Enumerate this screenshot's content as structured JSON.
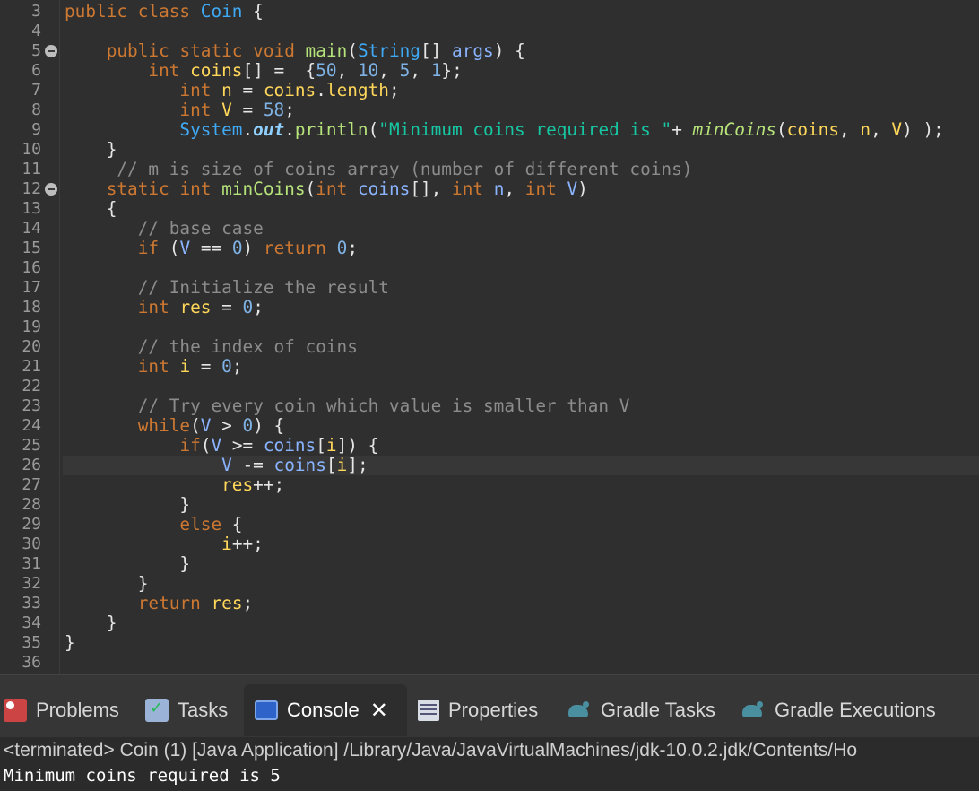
{
  "editor": {
    "line_numbers": [
      "3",
      "4",
      "5",
      "6",
      "7",
      "8",
      "9",
      "10",
      "11",
      "12",
      "13",
      "14",
      "15",
      "16",
      "17",
      "18",
      "19",
      "20",
      "21",
      "22",
      "23",
      "24",
      "25",
      "26",
      "27",
      "28",
      "29",
      "30",
      "31",
      "32",
      "33",
      "34",
      "35",
      "36"
    ]
  },
  "tabs": [
    {
      "label": "Problems",
      "icon": "problems-icon"
    },
    {
      "label": "Tasks",
      "icon": "tasks-icon"
    },
    {
      "label": "Console",
      "icon": "console-icon",
      "active": true
    },
    {
      "label": "Properties",
      "icon": "properties-icon"
    },
    {
      "label": "Gradle Tasks",
      "icon": "gradle-icon"
    },
    {
      "label": "Gradle Executions",
      "icon": "gradle-icon"
    }
  ],
  "console": {
    "status": "<terminated> Coin (1) [Java Application] /Library/Java/JavaVirtualMachines/jdk-10.0.2.jdk/Contents/Ho",
    "output": "Minimum coins required is 5"
  },
  "colors": {
    "editor_bg": "#2f2f2f",
    "keyword": "#cc7832",
    "string": "#17c6a3",
    "comment": "#8c8c8c"
  }
}
